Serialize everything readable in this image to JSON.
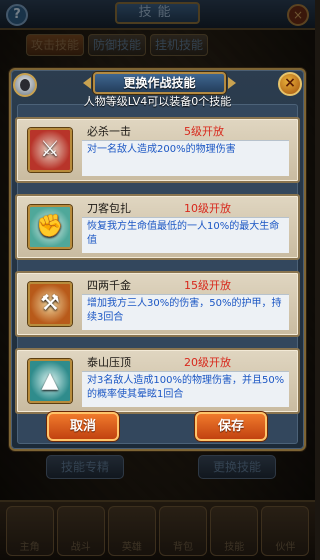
{
  "background": {
    "help_label": "?",
    "title": "技能",
    "close_label": "×",
    "tabs": [
      {
        "label": "攻击技能"
      },
      {
        "label": "防御技能"
      },
      {
        "label": "挂机技能"
      }
    ],
    "buttons": {
      "left": "技能专精",
      "right": "更换技能"
    },
    "nav": [
      {
        "label": "主角"
      },
      {
        "label": "战斗"
      },
      {
        "label": "英雄"
      },
      {
        "label": "背包"
      },
      {
        "label": "技能"
      },
      {
        "label": "伙伴"
      }
    ]
  },
  "dialog": {
    "title": "更换作战技能",
    "subtitle": "人物等级LV4可以装备0个技能",
    "close_label": "×",
    "skills": [
      {
        "name": "必杀一击",
        "unlock": "5级开放",
        "description": "对一名敌人造成200%的物理伤害",
        "icon": "sword-slash-icon"
      },
      {
        "name": "刀客包扎",
        "unlock": "10级开放",
        "description": "恢复我方生命值最低的一人10%的最大生命值",
        "icon": "bandage-fist-icon"
      },
      {
        "name": "四两千金",
        "unlock": "15级开放",
        "description": "增加我方三人30%的伤害，50%的护甲，持续3回合",
        "icon": "crossed-blade-icon"
      },
      {
        "name": "泰山压顶",
        "unlock": "20级开放",
        "description": "对3名敌人造成100%的物理伤害，并且50%的概率使其晕眩1回合",
        "icon": "mountain-crush-icon"
      }
    ],
    "cancel_label": "取消",
    "save_label": "保存"
  },
  "colors": {
    "unlock_text": "#d8281c",
    "description_text": "#1c57c4",
    "button_orange": "#e0621f",
    "frame_gold": "#b38a42"
  }
}
